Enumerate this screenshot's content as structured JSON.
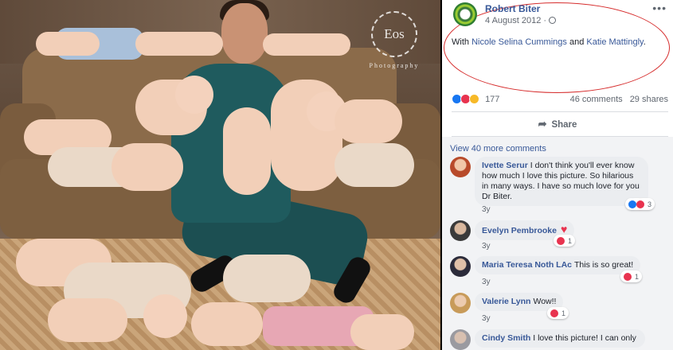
{
  "photo": {
    "watermark_main": "Eos",
    "watermark_sub": "Photography"
  },
  "post": {
    "author": "Robert Biter",
    "date": "4 August 2012 ·",
    "more_label": "•••",
    "with_prefix": "With",
    "tag1": "Nicole Selina Cummings",
    "and_word": "and",
    "tag2": "Katie Mattingly",
    "period": ".",
    "reaction_count": "177",
    "comments_count": "46 comments",
    "shares_count": "29 shares",
    "share_label": "Share"
  },
  "comments": {
    "view_more": "View 40 more comments",
    "items": [
      {
        "name": "Ivette Serur",
        "text": "I don't think you'll ever know how much I love this picture. So hilarious in many ways. I have so much love for you Dr Biter.",
        "age": "3y",
        "reactions": "3"
      },
      {
        "name": "Evelyn Pembrooke",
        "text": "",
        "age": "3y",
        "reactions": "1"
      },
      {
        "name": "Maria Teresa Noth LAc",
        "text": "This is so great!",
        "age": "3y",
        "reactions": "1"
      },
      {
        "name": "Valerie Lynn",
        "text": "Wow!!",
        "age": "3y",
        "reactions": "1"
      },
      {
        "name": "Cindy Smith",
        "text": "I love this picture! I can only",
        "age": "",
        "reactions": ""
      }
    ]
  },
  "colors": {
    "link": "#385898",
    "annotation_oval": "#d62d2d",
    "like": "#1877f2",
    "love": "#e8334f"
  }
}
